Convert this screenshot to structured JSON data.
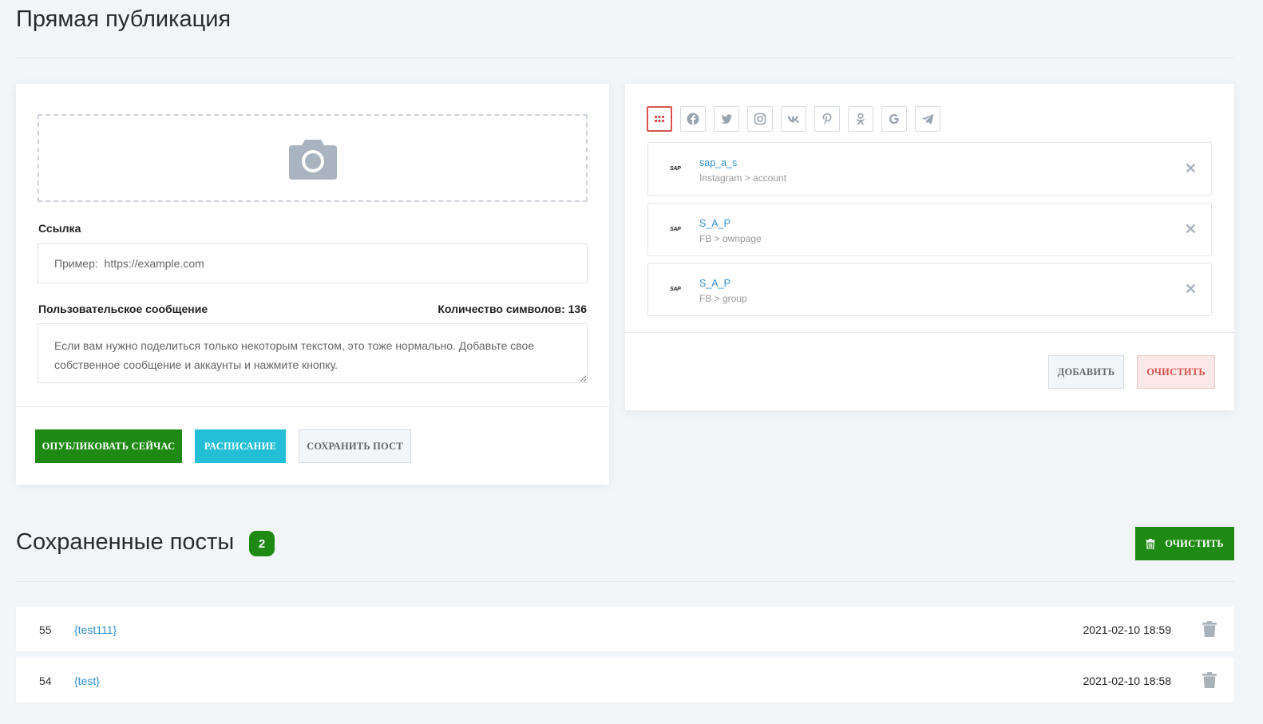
{
  "page": {
    "title": "Прямая публикация"
  },
  "composer": {
    "link_label": "Ссылка",
    "link_placeholder": "Пример:  https://example.com",
    "message_label": "Пользовательское сообщение",
    "char_count_label": "Количество символов: 136",
    "message_text": "Если вам нужно поделиться только некоторым текстом, это тоже нормально. Добавьте свое собственное сообщение и аккаунты и нажмите кнопку.",
    "publish_now": "Опубликовать сейчас",
    "schedule": "Расписание",
    "save_post": "Сохранить пост"
  },
  "networks": [
    "all-grid-icon",
    "facebook-icon",
    "twitter-icon",
    "instagram-icon",
    "vk-icon",
    "pinterest-icon",
    "odnoklassniki-icon",
    "google-icon",
    "telegram-icon"
  ],
  "accounts": [
    {
      "logo": "SAP",
      "name": "sap_a_s",
      "sub": "Instagram > account"
    },
    {
      "logo": "SAP",
      "name": "S_A_P",
      "sub": "FB > ownpage"
    },
    {
      "logo": "SAP",
      "name": "S_A_P",
      "sub": "FB > group"
    }
  ],
  "account_actions": {
    "add": "Добавить",
    "clear": "Очистить"
  },
  "saved": {
    "title": "Сохраненные посты",
    "count": "2",
    "clear_all": "Очистить",
    "posts": [
      {
        "id": "55",
        "name": "{test111}",
        "date": "2021-02-10 18:59"
      },
      {
        "id": "54",
        "name": "{test}",
        "date": "2021-02-10 18:58"
      }
    ]
  },
  "colors": {
    "green": "#1e8a13",
    "cyan": "#23bfd6",
    "red": "#d9534f",
    "link": "#2f8fd0"
  }
}
